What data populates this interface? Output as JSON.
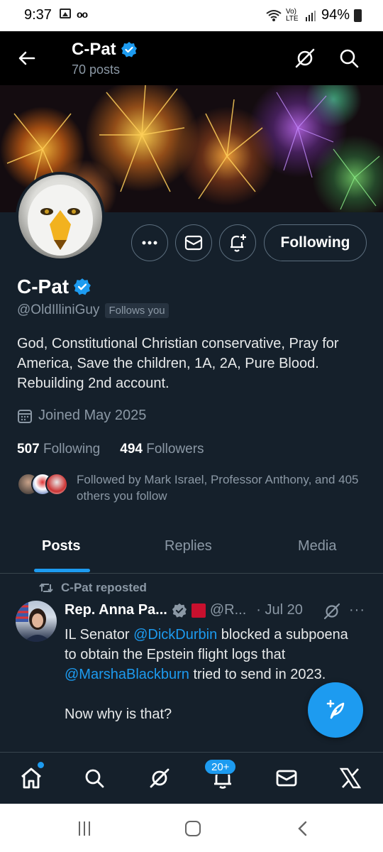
{
  "status_bar": {
    "time": "9:37",
    "battery": "94%",
    "network": "Vo) LTE"
  },
  "header": {
    "name": "C-Pat",
    "posts_count": "70 posts"
  },
  "profile": {
    "name": "C-Pat",
    "handle": "@OldIlliniGuy",
    "follows_you": "Follows you",
    "bio": "God, Constitutional Christian conservative, Pray for America, Save the children, 1A, 2A, Pure Blood. Rebuilding 2nd account.",
    "joined": "Joined May 2025",
    "following_count": "507",
    "following_label": "Following",
    "followers_count": "494",
    "followers_label": "Followers",
    "followed_by": "Followed by Mark Israel, Professor Anthony, and 405 others you follow",
    "following_button": "Following"
  },
  "tabs": [
    {
      "label": "Posts",
      "active": true
    },
    {
      "label": "Replies",
      "active": false
    },
    {
      "label": "Media",
      "active": false
    }
  ],
  "post": {
    "repost_label": "C-Pat reposted",
    "author_name": "Rep. Anna Pa...",
    "author_handle": "@R...",
    "date": "· Jul 20",
    "more": "···",
    "body_1": "IL Senator ",
    "mention_1": "@DickDurbin",
    "body_2": " blocked a subpoena to obtain the Epstein flight logs that ",
    "mention_2": "@MarshaBlackburn",
    "body_3": " tried to send in 2023.\n\nNow why is that?"
  },
  "bottom_nav": {
    "notifications_badge": "20+"
  },
  "colors": {
    "background": "#15202b",
    "accent": "#1d9bf0",
    "muted": "#8b98a5",
    "verified": "#1d9bf0"
  },
  "icons": [
    "back-arrow-icon",
    "grok-icon",
    "search-icon",
    "more-icon",
    "mail-icon",
    "bell-plus-icon",
    "calendar-icon",
    "repost-icon",
    "compose-icon",
    "home-icon",
    "bell-icon",
    "x-logo-icon"
  ]
}
